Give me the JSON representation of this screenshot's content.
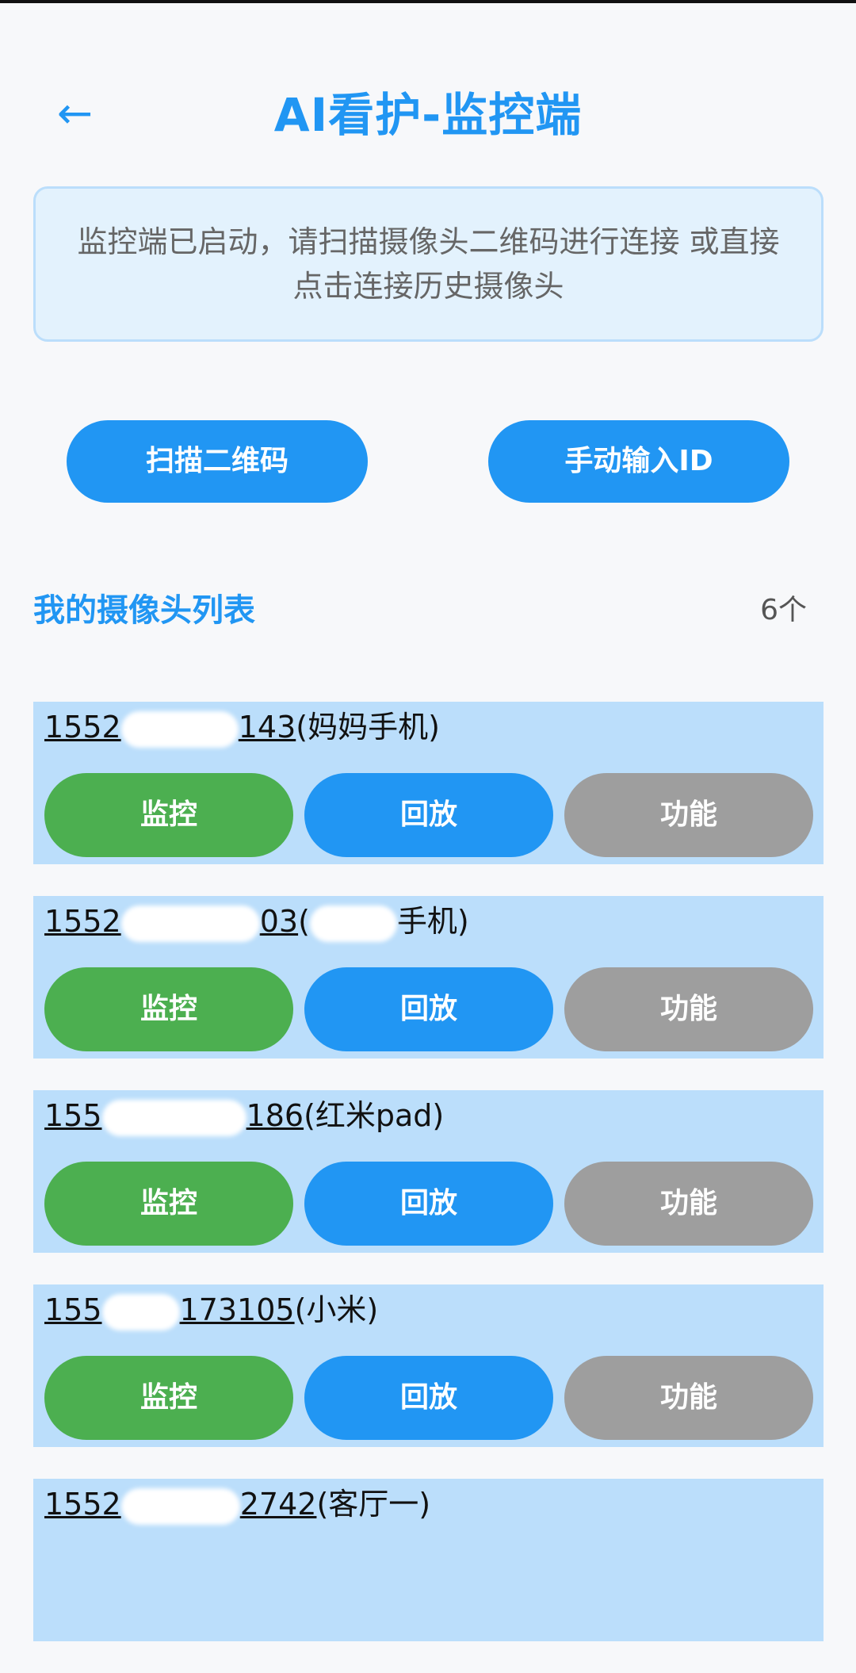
{
  "header": {
    "back_icon": "←",
    "title": "AI看护-监控端"
  },
  "info": {
    "message": "监控端已启动，请扫描摄像头二维码进行连接 或直接点击连接历史摄像头"
  },
  "actions": {
    "scan_label": "扫描二维码",
    "manual_label": "手动输入ID"
  },
  "camera_list": {
    "title": "我的摄像头列表",
    "count": "6个",
    "buttons": {
      "monitor": "监控",
      "playback": "回放",
      "function": "功能"
    },
    "items": [
      {
        "id_prefix": "1552",
        "id_suffix": "143",
        "name_prefix": "(妈妈手机)",
        "name_suffix": ""
      },
      {
        "id_prefix": "1552",
        "id_suffix": "03",
        "name_prefix": "(",
        "name_suffix": "手机)"
      },
      {
        "id_prefix": "155",
        "id_suffix": "186",
        "name_prefix": "(红米pad)",
        "name_suffix": ""
      },
      {
        "id_prefix": "155",
        "id_suffix": "173105",
        "name_prefix": "(小米)",
        "name_suffix": ""
      },
      {
        "id_prefix": "1552",
        "id_suffix": "2742",
        "name_prefix": "(客厅一)",
        "name_suffix": ""
      }
    ]
  },
  "colors": {
    "primary": "#2196f3",
    "monitor": "#4caf50",
    "function": "#9e9e9e",
    "card_bg": "#bbdefb"
  }
}
